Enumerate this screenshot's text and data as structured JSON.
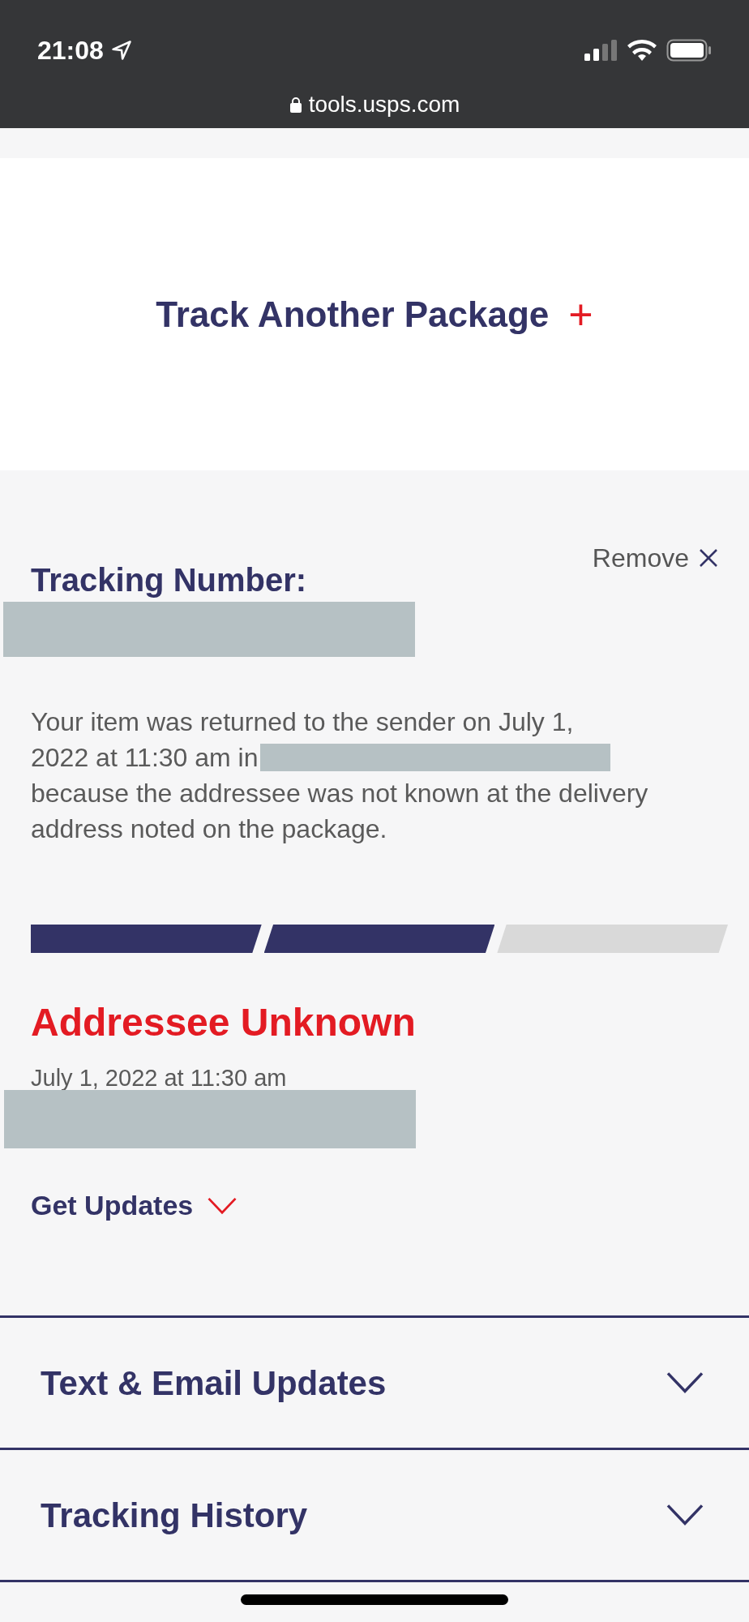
{
  "status_bar": {
    "time": "21:08",
    "url": "tools.usps.com"
  },
  "track_another": {
    "label": "Track Another Package",
    "icon": "+"
  },
  "tracking": {
    "remove_label": "Remove",
    "title": "Tracking Number:",
    "message_before": [
      "Your item was returned to the sender on July 1,",
      "2022 at 11:30 am in"
    ],
    "message_after": "because the addressee was not known at the delivery address noted on the package.",
    "progress_steps": [
      {
        "done": true
      },
      {
        "done": true
      },
      {
        "done": false
      }
    ],
    "status": "Addressee Unknown",
    "date": "July 1, 2022 at 11:30 am",
    "get_updates": {
      "label": "Get Updates",
      "expanded": false
    }
  },
  "sections": [
    {
      "label": "Text & Email Updates",
      "expanded": false
    },
    {
      "label": "Tracking History",
      "expanded": false
    }
  ]
}
